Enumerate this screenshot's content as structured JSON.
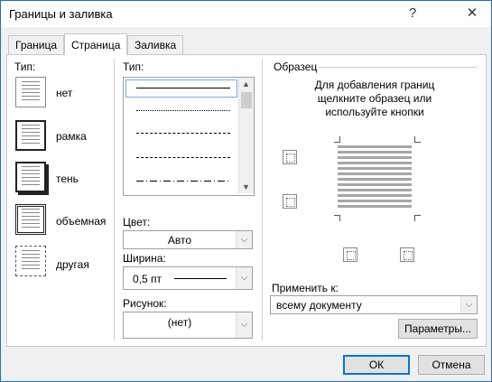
{
  "window": {
    "title": "Границы и заливка",
    "help_glyph": "?",
    "close_glyph": "✕"
  },
  "tabs": [
    {
      "label": "Граница",
      "active": false
    },
    {
      "label": "Страница",
      "active": true
    },
    {
      "label": "Заливка",
      "active": false
    }
  ],
  "setting": {
    "label": "Тип:",
    "options": [
      "нет",
      "рамка",
      "тень",
      "объемная",
      "другая"
    ]
  },
  "style": {
    "label": "Тип:",
    "line_styles": [
      "solid",
      "dotted",
      "dashed-fine",
      "dashed",
      "dash-dot"
    ]
  },
  "color": {
    "label": "Цвет:",
    "value": "Авто"
  },
  "width": {
    "label": "Ширина:",
    "value": "0,5 пт"
  },
  "art": {
    "label": "Рисунок:",
    "value": "(нет)"
  },
  "preview": {
    "label": "Образец",
    "hint_lines": [
      "Для добавления границ",
      "щелкните образец или",
      "используйте кнопки"
    ]
  },
  "apply_to": {
    "label": "Применить к:",
    "value": "всему документу"
  },
  "buttons": {
    "options": "Параметры...",
    "ok": "ОК",
    "cancel": "Отмена"
  }
}
